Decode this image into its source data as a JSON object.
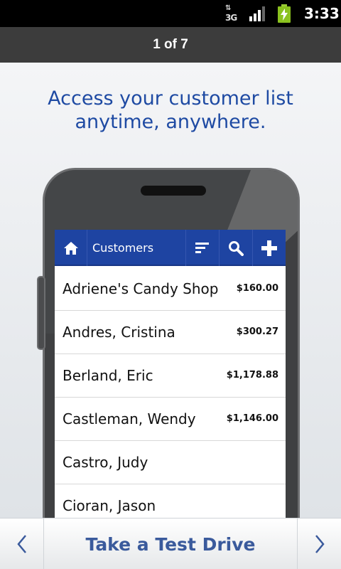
{
  "status_bar": {
    "network_label": "3G",
    "time": "3:33"
  },
  "pager": {
    "label": "1 of 7"
  },
  "headline": {
    "line1": "Access your customer list",
    "line2": "anytime, anywhere."
  },
  "app": {
    "title": "Customers",
    "icons": [
      "home-icon",
      "sort-icon",
      "search-icon",
      "add-icon"
    ],
    "accent_color": "#1e44a2",
    "customers": [
      {
        "name": "Adriene's Candy Shop",
        "amount": "$160.00"
      },
      {
        "name": "Andres, Cristina",
        "amount": "$300.27"
      },
      {
        "name": "Berland, Eric",
        "amount": "$1,178.88"
      },
      {
        "name": "Castleman, Wendy",
        "amount": "$1,146.00"
      },
      {
        "name": "Castro, Judy",
        "amount": ""
      },
      {
        "name": "Cioran, Jason",
        "amount": ""
      }
    ]
  },
  "bottom_nav": {
    "prev_icon": "chevron-left-icon",
    "cta_label": "Take a Test Drive",
    "next_icon": "chevron-right-icon"
  }
}
